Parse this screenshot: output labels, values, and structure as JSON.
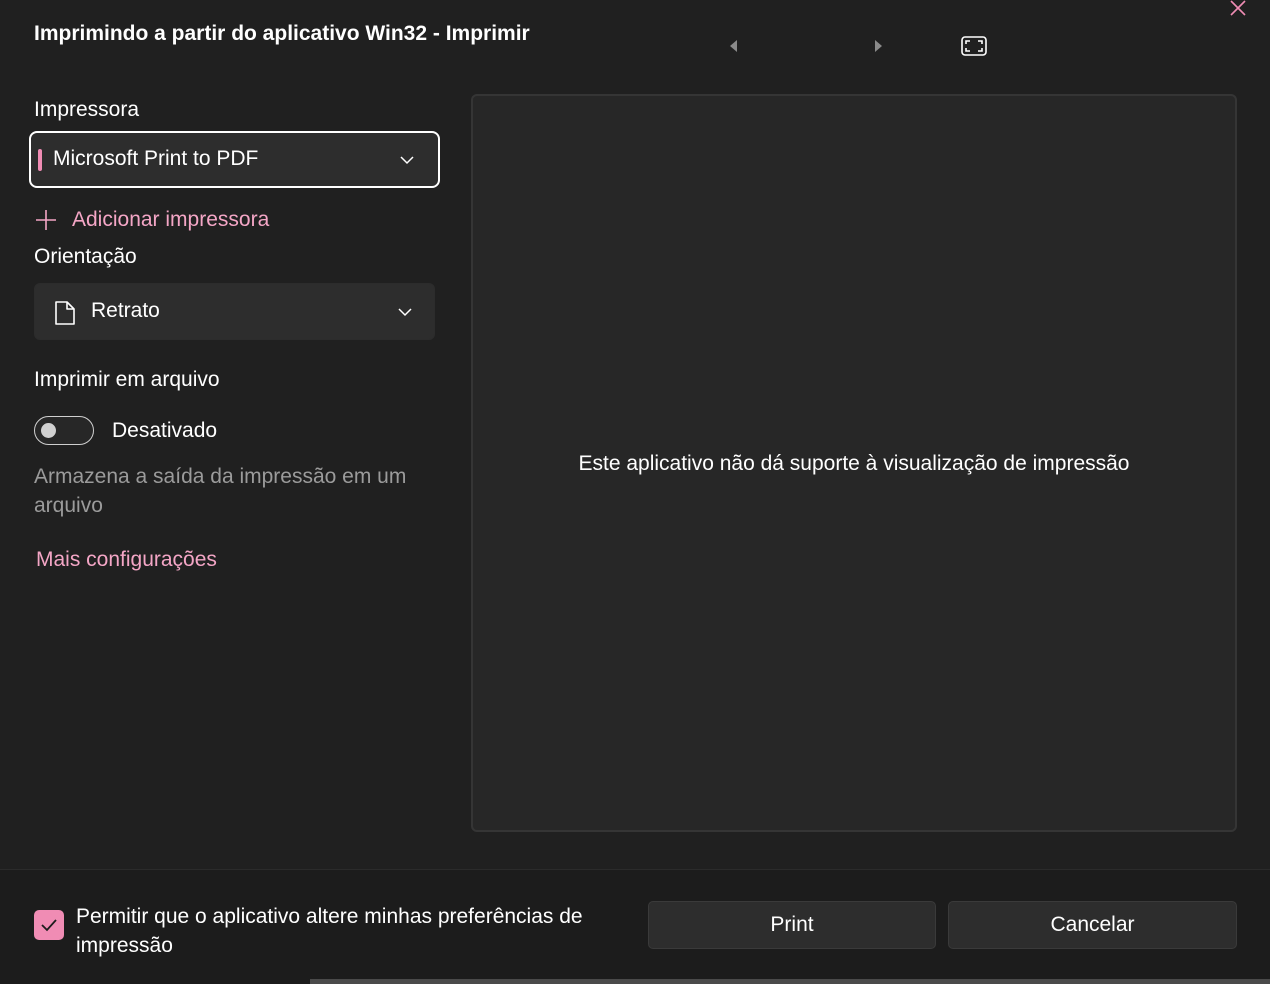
{
  "window": {
    "title": "Imprimindo a partir do aplicativo Win32 - Imprimir"
  },
  "icons": {
    "close": "close-icon",
    "prev": "caret-left-icon",
    "next": "caret-right-icon",
    "fit": "fit-to-window-icon",
    "add": "plus-icon",
    "document": "document-icon",
    "chevron": "chevron-down-icon",
    "check": "checkmark-icon"
  },
  "printer": {
    "label": "Impressora",
    "selected": "Microsoft Print to PDF",
    "add_label": "Adicionar impressora"
  },
  "orientation": {
    "label": "Orientação",
    "selected": "Retrato"
  },
  "print_to_file": {
    "label": "Imprimir em arquivo",
    "state_label": "Desativado",
    "enabled": false,
    "helper": "Armazena a saída da impressão em um arquivo"
  },
  "more_settings_label": "Mais configurações",
  "preview": {
    "message": "Este aplicativo não dá suporte à visualização de impressão"
  },
  "footer": {
    "allow_label": "Permitir que o aplicativo altere minhas preferências de impressão",
    "allow_checked": true,
    "print_label": "Print",
    "cancel_label": "Cancelar"
  },
  "colors": {
    "accent": "#f08cb4",
    "link": "#f4a6c6",
    "background": "#202020",
    "footer_background": "#1c1c1c"
  }
}
